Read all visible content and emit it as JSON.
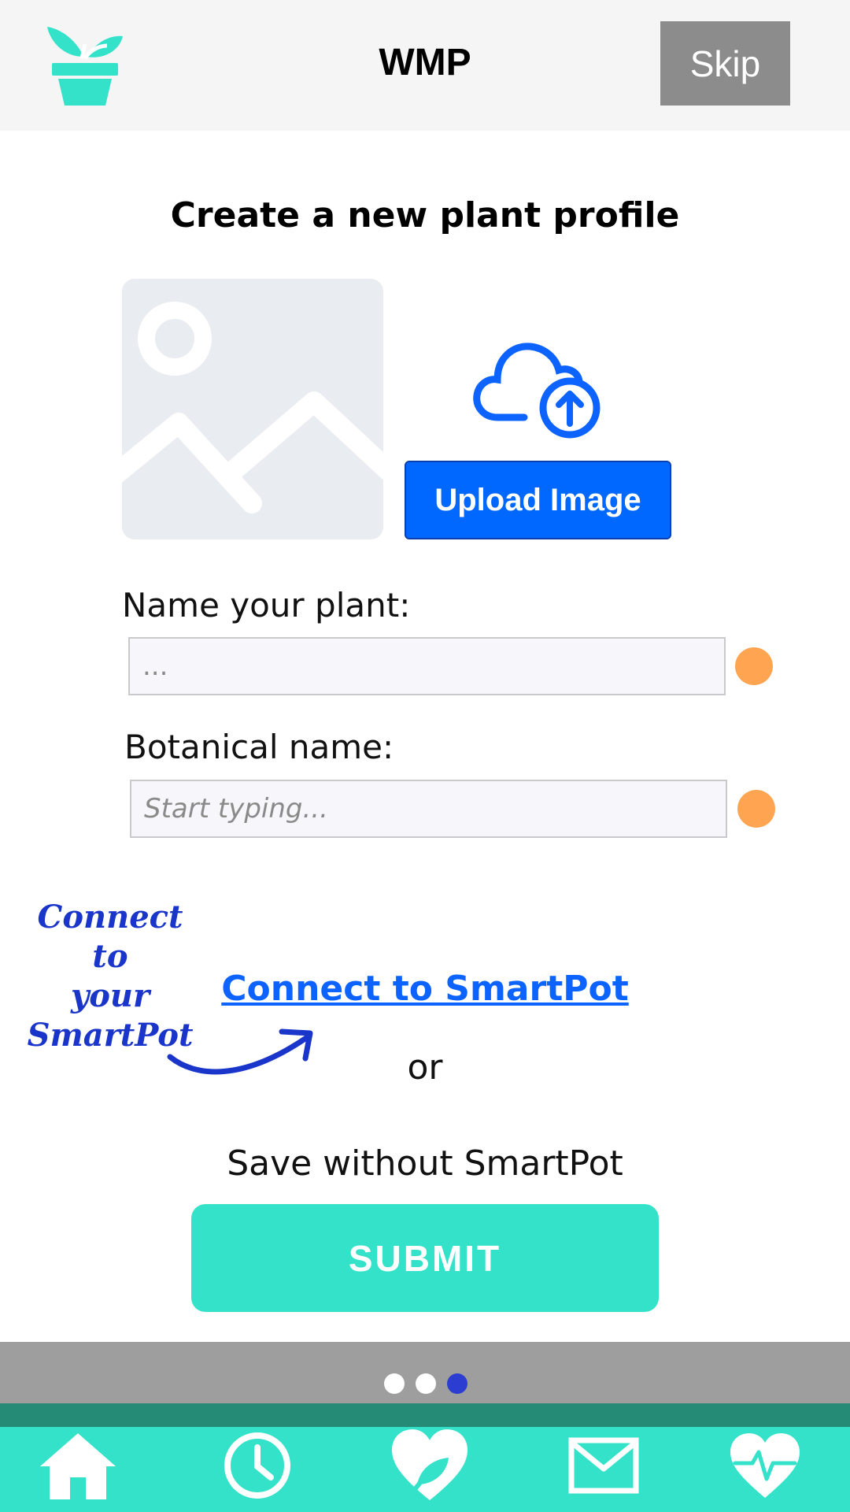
{
  "header": {
    "app_title": "WMP",
    "skip_label": "Skip",
    "logo_icon": "plant-pot-icon"
  },
  "main": {
    "title": "Create a new plant profile",
    "upload_label": "Upload Image",
    "image_placeholder_icon": "image-placeholder-icon",
    "upload_icon": "cloud-upload-icon"
  },
  "form": {
    "name_label": "Name your plant:",
    "name_value": "...",
    "botanical_label": "Botanical name:",
    "botanical_placeholder": "Start typing..."
  },
  "smartpot": {
    "annotation_lines": [
      "Connect to",
      "your",
      "SmartPot"
    ],
    "connect_link": "Connect to SmartPot",
    "or_text": "or",
    "save_without": "Save without SmartPot"
  },
  "submit_label": "SUBMIT",
  "pager": {
    "total": 3,
    "active_index": 2
  },
  "bottom_nav": [
    {
      "icon": "home-icon"
    },
    {
      "icon": "clock-icon"
    },
    {
      "icon": "heart-leaf-icon"
    },
    {
      "icon": "mail-icon"
    },
    {
      "icon": "heart-pulse-icon"
    }
  ],
  "colors": {
    "accent": "#33e2c9",
    "primary_blue": "#0068ff",
    "status_dot": "#ffa552",
    "handwriting": "#1a35c9"
  }
}
